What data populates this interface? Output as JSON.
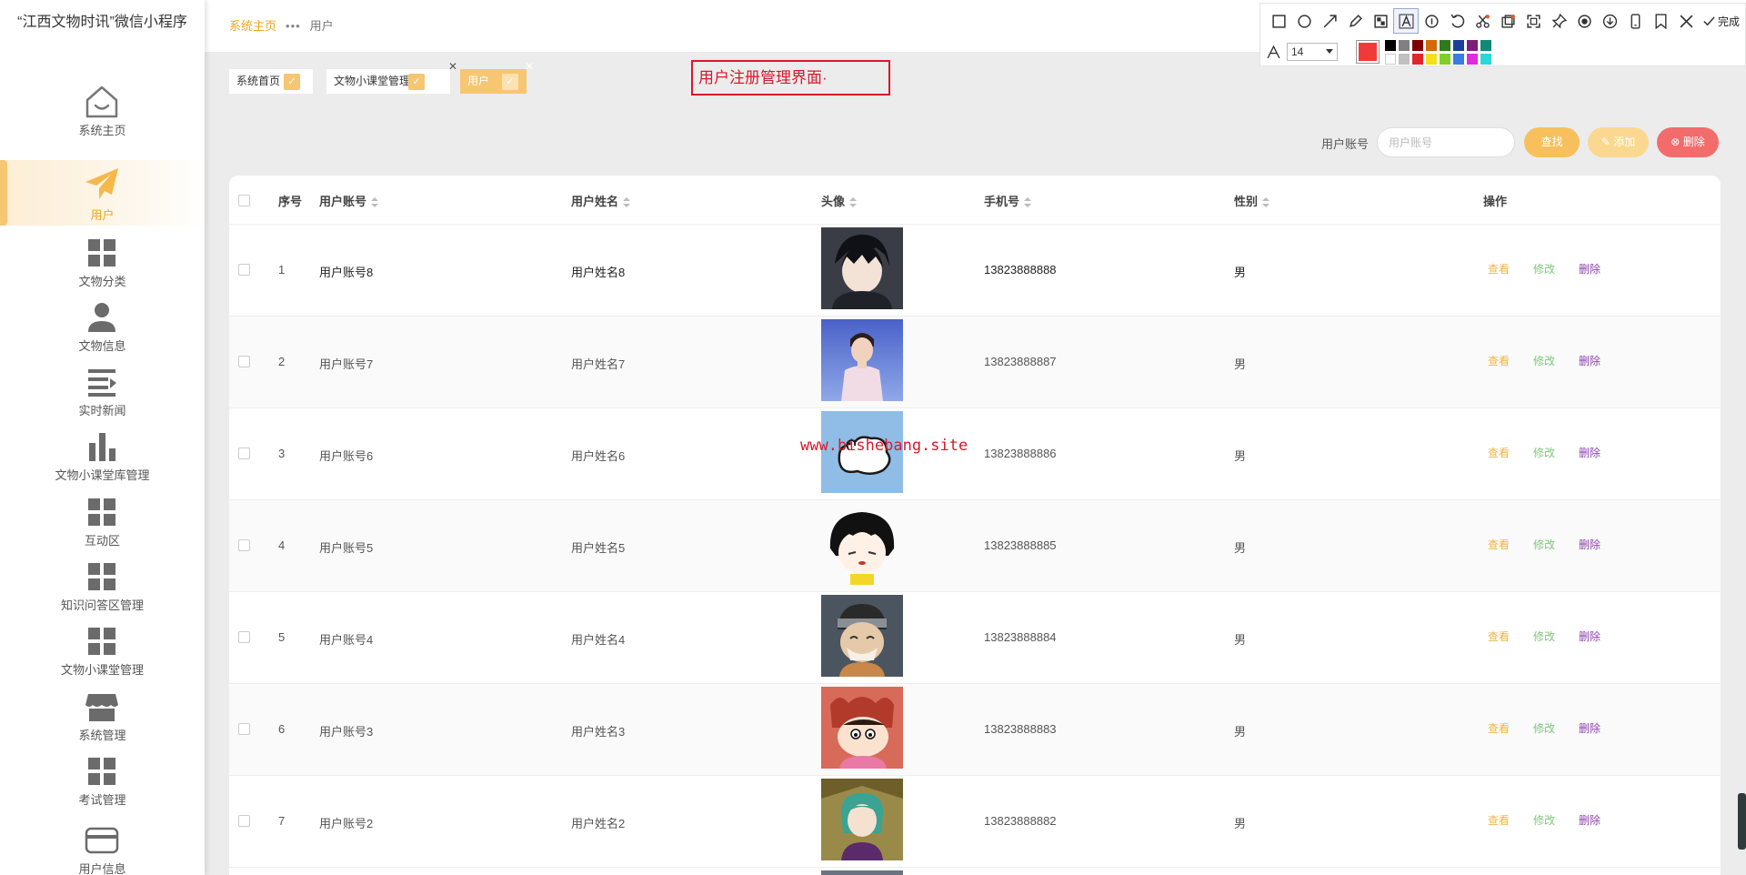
{
  "app": {
    "title": "“江西文物时讯”微信小程序"
  },
  "sidebar": {
    "items": [
      {
        "label": "系统主页",
        "icon": "home-icon"
      },
      {
        "label": "用户",
        "icon": "paper-plane-icon",
        "active": true
      },
      {
        "label": "文物分类",
        "icon": "grid-icon"
      },
      {
        "label": "文物信息",
        "icon": "user-icon"
      },
      {
        "label": "实时新闻",
        "icon": "list-icon"
      },
      {
        "label": "文物小课堂库管理",
        "icon": "bar-chart-icon"
      },
      {
        "label": "互动区",
        "icon": "grid-icon"
      },
      {
        "label": "知识问答区管理",
        "icon": "grid-icon"
      },
      {
        "label": "文物小课堂管理",
        "icon": "grid-icon"
      },
      {
        "label": "系统管理",
        "icon": "store-icon"
      },
      {
        "label": "考试管理",
        "icon": "grid-icon"
      },
      {
        "label": "用户信息",
        "icon": "card-icon"
      }
    ]
  },
  "header": {
    "breadcrumb_home": "系统主页",
    "breadcrumb_sep": "•••",
    "breadcrumb_current": "用户"
  },
  "tags": [
    {
      "label": "系统首页"
    },
    {
      "label": "文物小课堂管理"
    },
    {
      "label": "用户",
      "active": true
    }
  ],
  "annotation": {
    "label": "用户注册管理界面·",
    "font_size": "14",
    "done_label": "完成",
    "current_color": "#f03a3a"
  },
  "watermark": "www.bishebang.site",
  "search": {
    "label": "用户账号",
    "placeholder": "用户账号",
    "search_button": "查找",
    "add_button": "添加",
    "delete_button": "删除"
  },
  "table": {
    "columns": [
      "序号",
      "用户账号",
      "用户姓名",
      "头像",
      "手机号",
      "性别",
      "操作"
    ],
    "actions": {
      "view": "查看",
      "edit": "修改",
      "delete": "删除"
    },
    "rows": [
      {
        "index": "1",
        "account": "用户账号8",
        "name": "用户姓名8",
        "phone": "13823888888",
        "sex": "男"
      },
      {
        "index": "2",
        "account": "用户账号7",
        "name": "用户姓名7",
        "phone": "13823888887",
        "sex": "男"
      },
      {
        "index": "3",
        "account": "用户账号6",
        "name": "用户姓名6",
        "phone": "13823888886",
        "sex": "男"
      },
      {
        "index": "4",
        "account": "用户账号5",
        "name": "用户姓名5",
        "phone": "13823888885",
        "sex": "男"
      },
      {
        "index": "5",
        "account": "用户账号4",
        "name": "用户姓名4",
        "phone": "13823888884",
        "sex": "男"
      },
      {
        "index": "6",
        "account": "用户账号3",
        "name": "用户姓名3",
        "phone": "13823888883",
        "sex": "男"
      },
      {
        "index": "7",
        "account": "用户账号2",
        "name": "用户姓名2",
        "phone": "13823888882",
        "sex": "男"
      }
    ]
  },
  "colors": {
    "accent": "#f7c05c",
    "active_text": "#f0a51c",
    "danger": "#f36c6c",
    "edit": "#7fc77a",
    "delete_link": "#8e44ad",
    "annotation_red": "#d9182a"
  }
}
